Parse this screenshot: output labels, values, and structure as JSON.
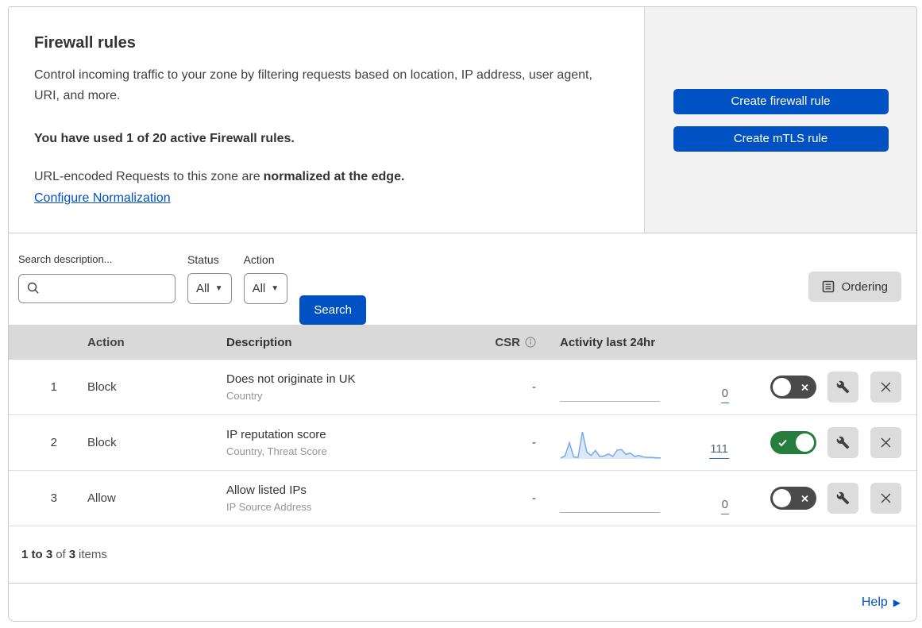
{
  "header": {
    "title": "Firewall rules",
    "description": "Control incoming traffic to your zone by filtering requests based on location, IP address, user agent, URI, and more.",
    "usage": "You have used 1 of 20 active Firewall rules.",
    "normalization_text": "URL-encoded Requests to this zone are",
    "normalization_bold": "normalized at the edge.",
    "normalization_link": "Configure Normalization",
    "buttons": [
      {
        "label": "Create firewall rule"
      },
      {
        "label": "Create mTLS rule"
      }
    ]
  },
  "filters": {
    "search_label": "Search description...",
    "search_value": "",
    "status_label": "Status",
    "status_value": "All",
    "action_label": "Action",
    "action_value": "All",
    "search_button": "Search",
    "ordering_button": "Ordering"
  },
  "table": {
    "columns": {
      "action": "Action",
      "description": "Description",
      "csr": "CSR",
      "activity": "Activity last 24hr"
    },
    "rows": [
      {
        "index": "1",
        "action": "Block",
        "description": "Does not originate in UK",
        "fields": "Country",
        "csr": "-",
        "count": "0",
        "enabled": false,
        "sparkline": null
      },
      {
        "index": "2",
        "action": "Block",
        "description": "IP reputation score",
        "fields": "Country, Threat Score",
        "csr": "-",
        "count": "111",
        "enabled": true,
        "sparkline": [
          2,
          6,
          33,
          4,
          3,
          55,
          14,
          7,
          17,
          5,
          6,
          10,
          5,
          18,
          19,
          9,
          12,
          5,
          7,
          4,
          3,
          3,
          2,
          2
        ]
      },
      {
        "index": "3",
        "action": "Allow",
        "description": "Allow listed IPs",
        "fields": "IP Source Address",
        "csr": "-",
        "count": "0",
        "enabled": false,
        "sparkline": null
      }
    ]
  },
  "footer": {
    "range": "1 to 3",
    "of": "of",
    "total": "3",
    "items_label": "items"
  },
  "help": {
    "label": "Help"
  },
  "colors": {
    "primary_blue": "#0051c3",
    "toggle_on_green": "#267d3e",
    "toggle_off_gray": "#4a4a4a",
    "sparkline_line": "#78a9ea",
    "sparkline_fill": "#dce9f8",
    "table_header_bg": "#d9d9d9"
  }
}
